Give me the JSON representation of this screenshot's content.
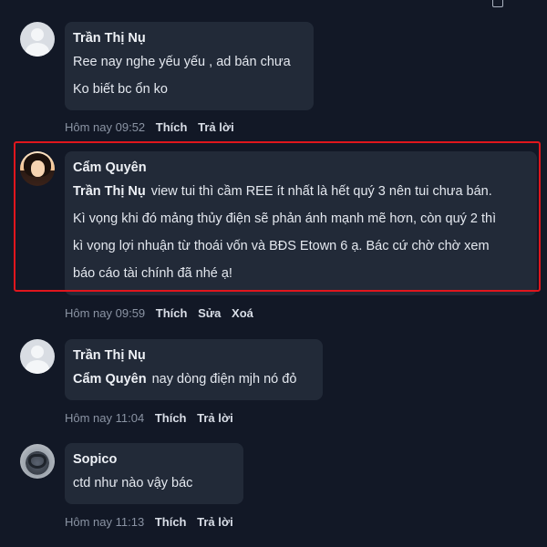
{
  "comments": [
    {
      "author": "Trần Thị Nụ",
      "avatar": "default-user-avatar",
      "lines": [
        "Ree nay nghe yếu yếu , ad bán chưa",
        "Ko biết bc ổn ko"
      ],
      "time": "Hôm nay 09:52",
      "actions": [
        "Thích",
        "Trả lời"
      ]
    },
    {
      "author": "Cẩm Quyên",
      "avatar": "girl-photo-avatar",
      "mention": "Trần Thị Nụ",
      "lines": [
        "view tui thì cầm REE ít nhất là hết quý 3 nên tui chưa bán.",
        "Kì vọng khi đó mảng thủy điện sẽ phản ánh mạnh mẽ hơn, còn quý 2 thì",
        "kì vọng lợi nhuận từ thoái vốn và BĐS Etown 6 ạ. Bác cứ chờ chờ xem",
        "báo cáo tài chính đã nhé ạ!"
      ],
      "time": "Hôm nay 09:59",
      "actions": [
        "Thích",
        "Sửa",
        "Xoá"
      ],
      "highlighted": true,
      "highlight_color": "#e0161d"
    },
    {
      "author": "Trần Thị Nụ",
      "avatar": "default-user-avatar",
      "mention": "Cẩm Quyên",
      "lines": [
        "nay dòng điện mjh nó đỏ"
      ],
      "time": "Hôm nay 11:04",
      "actions": [
        "Thích",
        "Trả lời"
      ]
    },
    {
      "author": "Sopico",
      "avatar": "car-photo-avatar",
      "lines": [
        "ctd như nào vậy bác"
      ],
      "time": "Hôm nay 11:13",
      "actions": [
        "Thích",
        "Trả lời"
      ]
    }
  ],
  "colors": {
    "background": "#121826",
    "bubble": "#222a38",
    "meta_text": "#8a93a3"
  }
}
